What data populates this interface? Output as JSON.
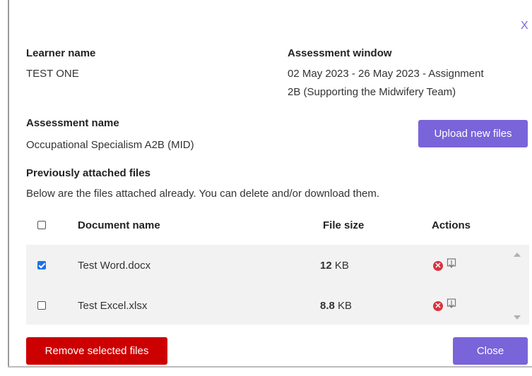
{
  "dialog": {
    "close_glyph": "X",
    "learner_name_label": "Learner name",
    "learner_name_value": "TEST ONE",
    "assessment_window_label": "Assessment window",
    "assessment_window_line1": "02 May 2023 - 26 May 2023 - Assignment",
    "assessment_window_line2": "2B (Supporting the Midwifery Team)",
    "assessment_name_label": "Assessment name",
    "assessment_name_value": "Occupational Specialism A2B (MID)",
    "upload_button": "Upload new files",
    "previous_files_label": "Previously attached files",
    "previous_files_description": "Below are the files attached already. You can delete and/or download them.",
    "remove_button": "Remove selected files",
    "close_button": "Close"
  },
  "table": {
    "columns": [
      "Document name",
      "File size",
      "Actions"
    ],
    "select_all_checked": false,
    "rows": [
      {
        "checked": true,
        "name": "Test Word.docx",
        "size_value": "12",
        "size_unit": "KB"
      },
      {
        "checked": false,
        "name": "Test Excel.xlsx",
        "size_value": "8.8",
        "size_unit": "KB"
      }
    ]
  },
  "icons": {
    "delete": "x-circle-icon",
    "download": "download-icon"
  },
  "colors": {
    "accent_purple": "#7a64d9",
    "danger_red": "#cc0000",
    "delete_icon_red": "#d9333f",
    "checkbox_blue": "#1a73e8",
    "row_background": "#f2f2f2"
  }
}
